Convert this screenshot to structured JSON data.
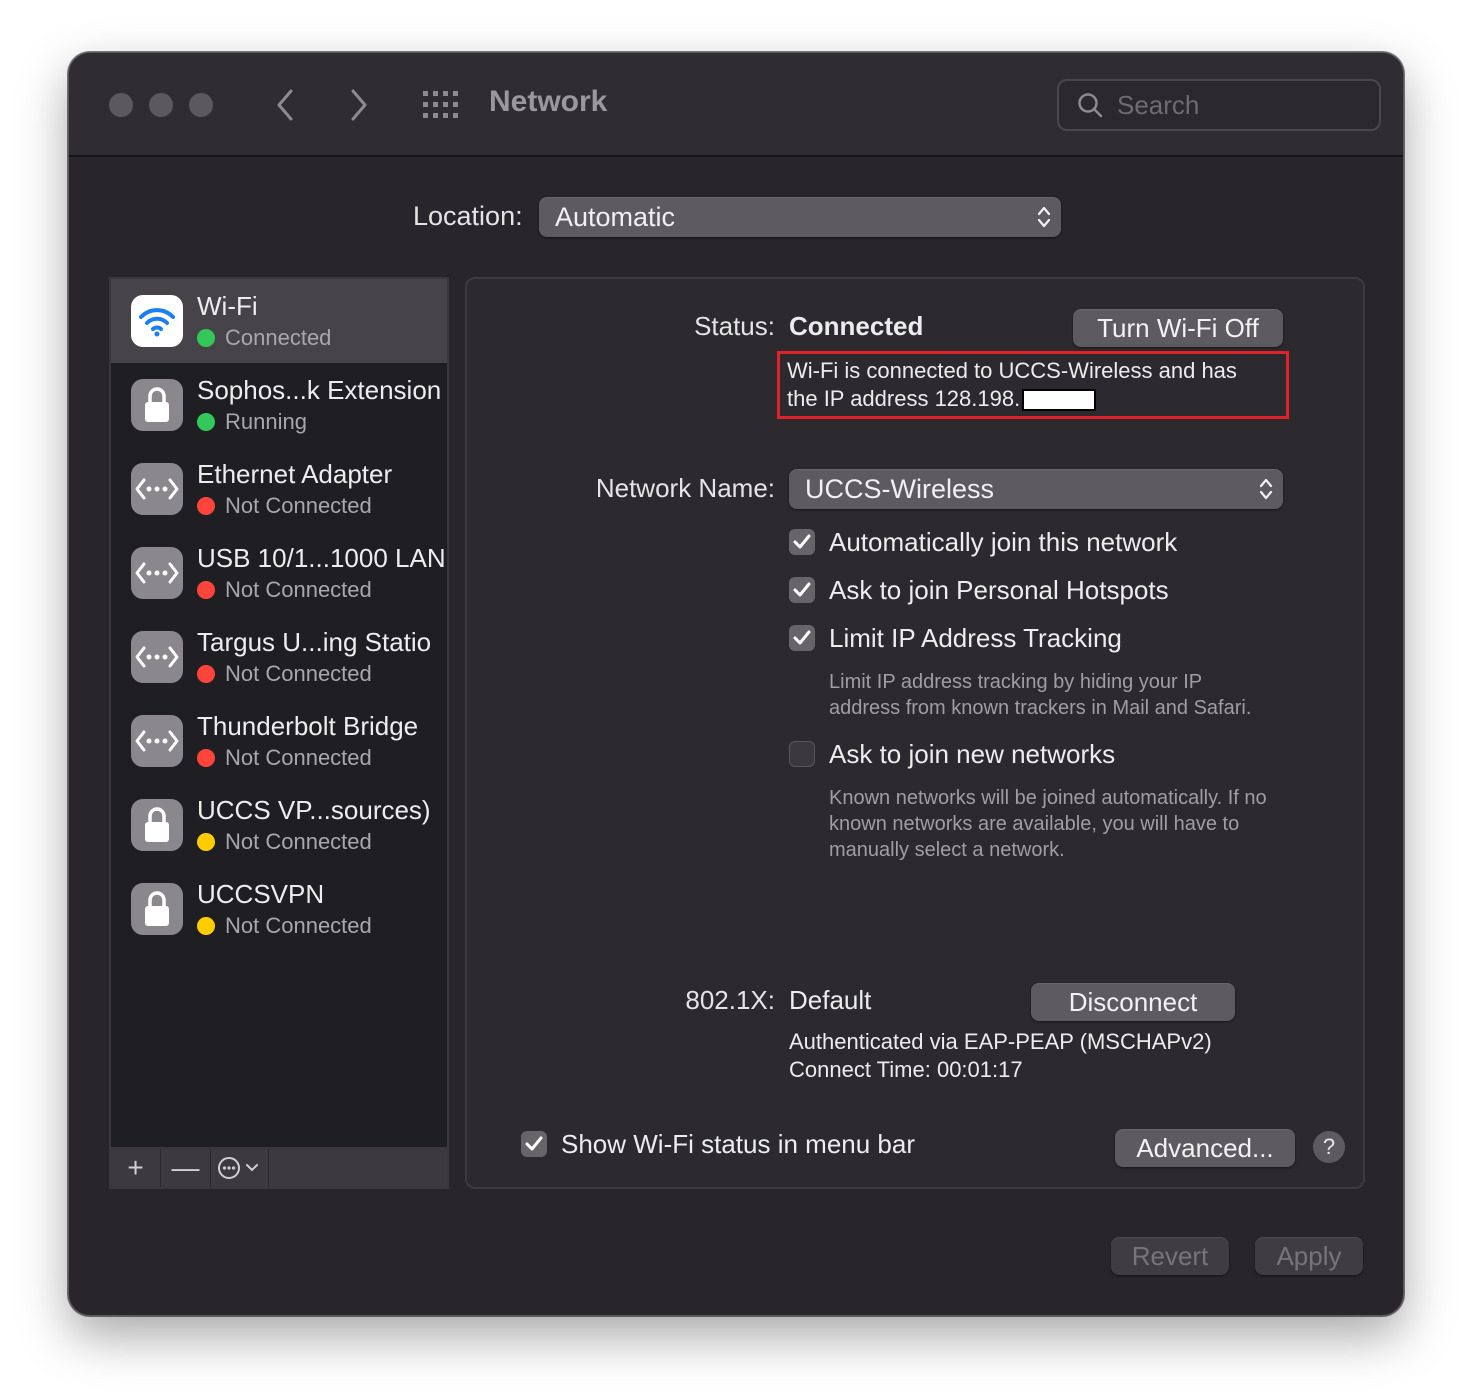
{
  "window": {
    "title": "Network",
    "search_placeholder": "Search"
  },
  "location": {
    "label": "Location:",
    "value": "Automatic"
  },
  "services": [
    {
      "name": "Wi-Fi",
      "status": "Connected",
      "status_color": "#34c759",
      "icon": "wifi-icon",
      "selected": true
    },
    {
      "name": "Sophos...k Extension",
      "status": "Running",
      "status_color": "#34c759",
      "icon": "lock-icon"
    },
    {
      "name": "Ethernet Adapter",
      "status": "Not Connected",
      "status_color": "#ff453a",
      "icon": "ethernet-icon"
    },
    {
      "name": "USB 10/1...1000 LAN",
      "status": "Not Connected",
      "status_color": "#ff453a",
      "icon": "ethernet-icon"
    },
    {
      "name": "Targus U...ing Statio",
      "status": "Not Connected",
      "status_color": "#ff453a",
      "icon": "ethernet-icon"
    },
    {
      "name": "Thunderbolt Bridge",
      "status": "Not Connected",
      "status_color": "#ff453a",
      "icon": "ethernet-icon"
    },
    {
      "name": "UCCS VP...sources)",
      "status": "Not Connected",
      "status_color": "#ffcc00",
      "icon": "lock-icon"
    },
    {
      "name": "UCCSVPN",
      "status": "Not Connected",
      "status_color": "#ffcc00",
      "icon": "lock-icon"
    }
  ],
  "toolbar": {
    "add": "+",
    "remove": "—"
  },
  "detail": {
    "status_label": "Status:",
    "status_value": "Connected",
    "turn_off_button": "Turn Wi-Fi Off",
    "status_desc_line1": "Wi-Fi is connected to UCCS-Wireless and has",
    "status_desc_line2": "the IP address 128.198.",
    "network_name_label": "Network Name:",
    "network_name_value": "UCCS-Wireless",
    "auto_join_label": "Automatically join this network",
    "auto_join_checked": true,
    "hotspots_label": "Ask to join Personal Hotspots",
    "hotspots_checked": true,
    "limit_ip_label": "Limit IP Address Tracking",
    "limit_ip_checked": true,
    "limit_ip_help_line1": "Limit IP address tracking by hiding your IP",
    "limit_ip_help_line2": "address from known trackers in Mail and Safari.",
    "ask_new_label": "Ask to join new networks",
    "ask_new_checked": false,
    "ask_new_help_line1": "Known networks will be joined automatically. If no",
    "ask_new_help_line2": "known networks are available, you will have to",
    "ask_new_help_line3": "manually select a network.",
    "dot1x_label": "802.1X:",
    "dot1x_value": "Default",
    "disconnect_button": "Disconnect",
    "auth_line": "Authenticated via EAP-PEAP (MSCHAPv2)",
    "connect_time": "Connect Time: 00:01:17",
    "show_status_label": "Show Wi-Fi status in menu bar",
    "show_status_checked": true,
    "advanced_button": "Advanced...",
    "help_button": "?"
  },
  "footer": {
    "revert_button": "Revert",
    "apply_button": "Apply"
  },
  "colors": {
    "highlight_box": "#e0222a",
    "connected_green": "#34c759",
    "disconnected_red": "#ff453a",
    "vpn_yellow": "#ffcc00"
  }
}
